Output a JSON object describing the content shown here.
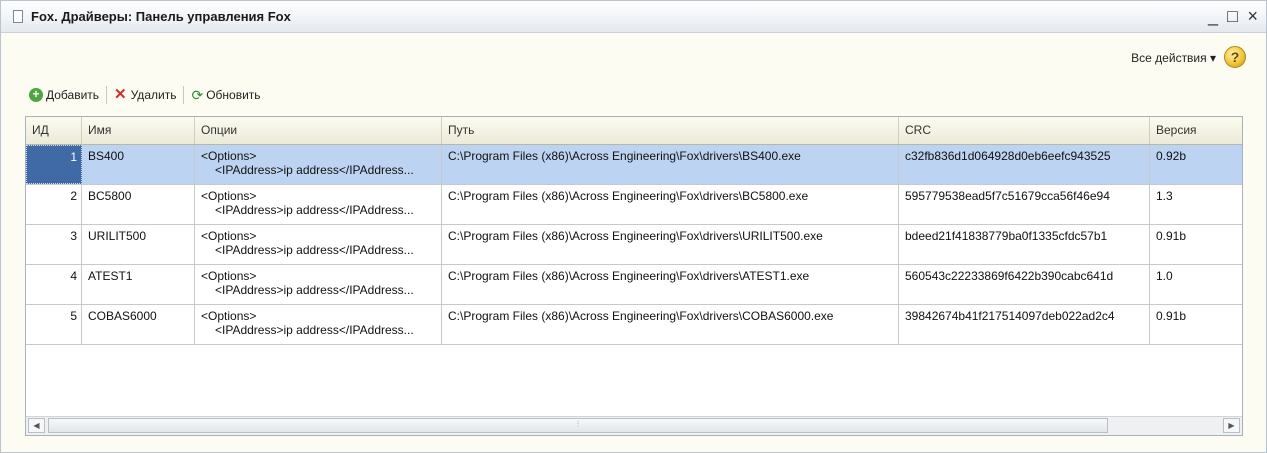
{
  "window": {
    "title": "Fox. Драйверы: Панель управления Fox",
    "minimize_glyph": "_",
    "maximize_glyph": "□",
    "close_glyph": "×"
  },
  "actions": {
    "all_actions_label": "Все действия ▾",
    "help_glyph": "?"
  },
  "toolbar": {
    "add_label": "Добавить",
    "delete_label": "Удалить",
    "refresh_label": "Обновить",
    "add_icon": "plus-icon",
    "delete_icon": "delete-x-icon",
    "refresh_icon": "refresh-icon"
  },
  "grid": {
    "columns": [
      "ИД",
      "Имя",
      "Опции",
      "Путь",
      "CRC",
      "Версия"
    ],
    "rows": [
      {
        "id": "1",
        "name": "BS400",
        "options_line1": "<Options>",
        "options_line2": "<IPAddress>ip address</IPAddress...",
        "path": "C:\\Program Files (x86)\\Across Engineering\\Fox\\drivers\\BS400.exe",
        "crc": "c32fb836d1d064928d0eb6eefc943525",
        "version": "0.92b"
      },
      {
        "id": "2",
        "name": "BC5800",
        "options_line1": "<Options>",
        "options_line2": "<IPAddress>ip address</IPAddress...",
        "path": "C:\\Program Files (x86)\\Across Engineering\\Fox\\drivers\\BC5800.exe",
        "crc": "595779538ead5f7c51679cca56f46e94",
        "version": "1.3"
      },
      {
        "id": "3",
        "name": "URILIT500",
        "options_line1": "<Options>",
        "options_line2": "<IPAddress>ip address</IPAddress...",
        "path": "C:\\Program Files (x86)\\Across Engineering\\Fox\\drivers\\URILIT500.exe",
        "crc": "bdeed21f41838779ba0f1335cfdc57b1",
        "version": "0.91b"
      },
      {
        "id": "4",
        "name": "ATEST1",
        "options_line1": "<Options>",
        "options_line2": "<IPAddress>ip address</IPAddress...",
        "path": "C:\\Program Files (x86)\\Across Engineering\\Fox\\drivers\\ATEST1.exe",
        "crc": "560543c22233869f6422b390cabc641d",
        "version": "1.0"
      },
      {
        "id": "5",
        "name": "COBAS6000",
        "options_line1": "<Options>",
        "options_line2": "<IPAddress>ip address</IPAddress...",
        "path": "C:\\Program Files (x86)\\Across Engineering\\Fox\\drivers\\COBAS6000.exe",
        "crc": "39842674b41f217514097deb022ad2c4",
        "version": "0.91b"
      }
    ],
    "selected_row": "1"
  },
  "colors": {
    "selection": "#bcd4f2",
    "selected_id_cell": "#3f6aa6",
    "window_bg": "#fcfcf2"
  }
}
